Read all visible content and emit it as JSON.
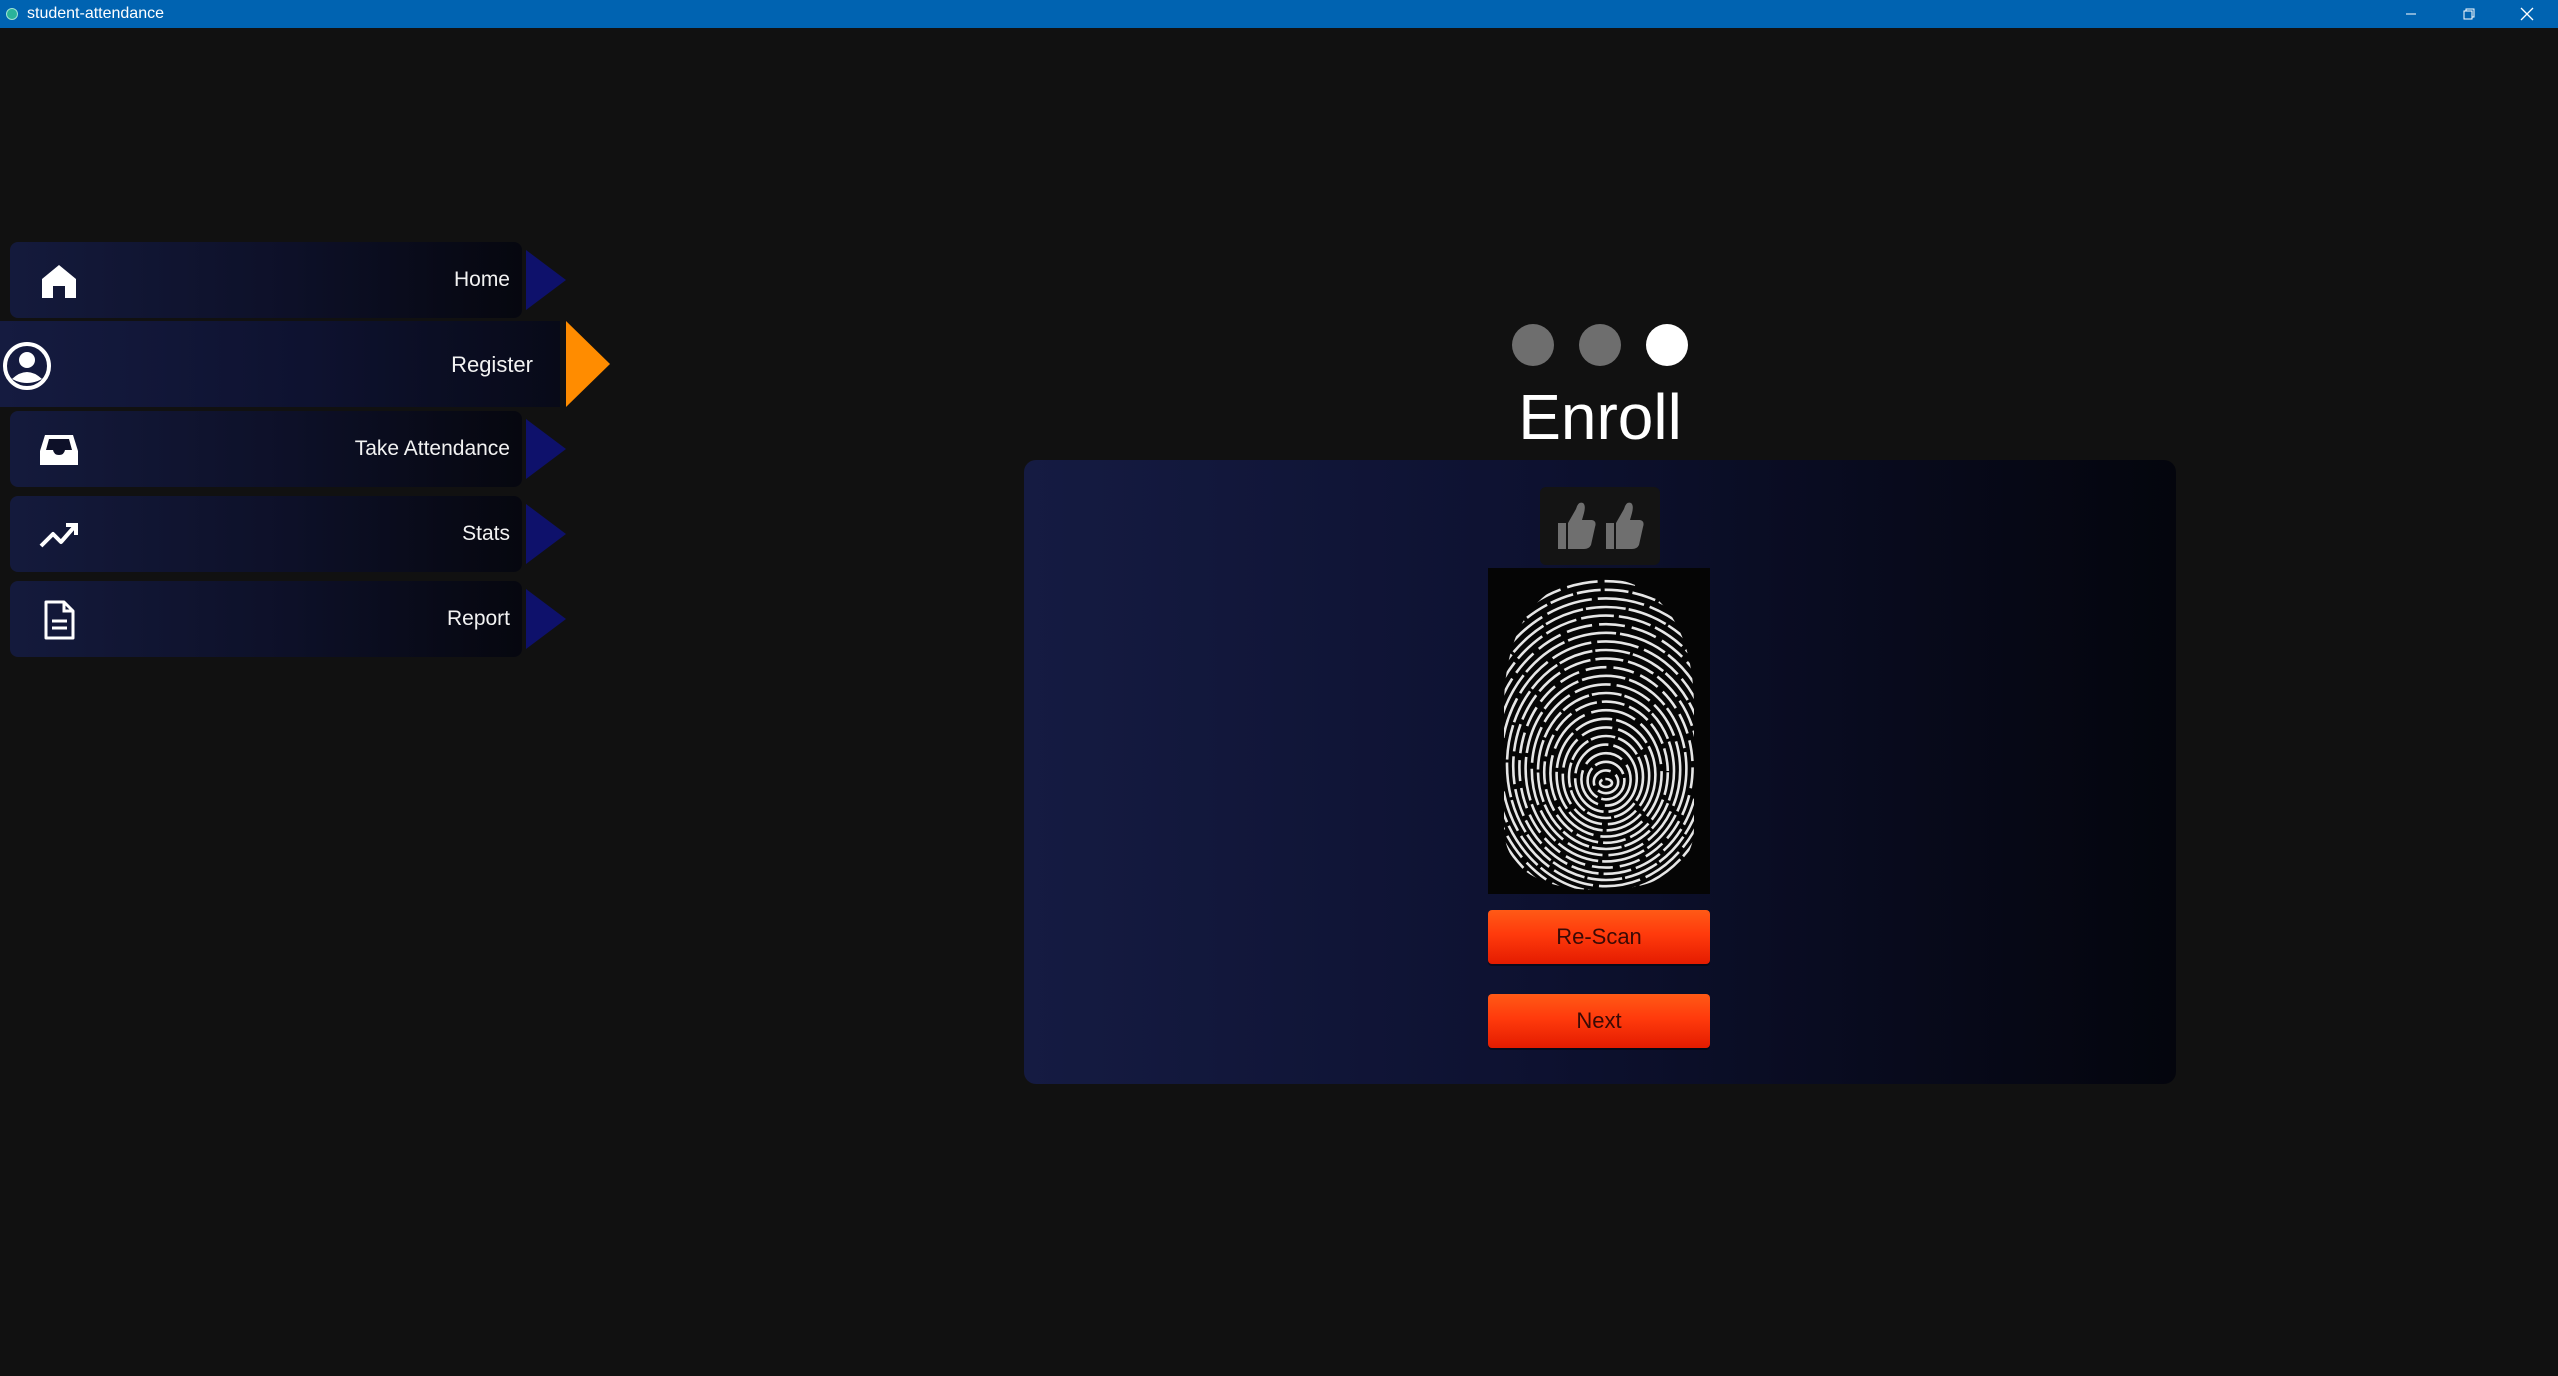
{
  "window": {
    "title": "student-attendance",
    "buttons": [
      "minimize",
      "restore",
      "close"
    ]
  },
  "sidebar": {
    "items": [
      {
        "label": "Home",
        "icon": "home-icon",
        "active": false
      },
      {
        "label": "Register",
        "icon": "user-circle-icon",
        "active": true
      },
      {
        "label": "Take Attendance",
        "icon": "inbox-icon",
        "active": false
      },
      {
        "label": "Stats",
        "icon": "trending-up-icon",
        "active": false
      },
      {
        "label": "Report",
        "icon": "document-icon",
        "active": false
      }
    ],
    "active_arrow_color": "#ff8c00",
    "inactive_arrow_color": "#0e116b"
  },
  "stepper": {
    "steps": 3,
    "current": 3
  },
  "enroll": {
    "title": "Enroll",
    "badge_icon": "thumbs-up-icon",
    "rescan_label": "Re-Scan",
    "next_label": "Next"
  },
  "colors": {
    "background": "#111111",
    "titlebar": "#0063b1",
    "button": "#ff3a0c"
  }
}
